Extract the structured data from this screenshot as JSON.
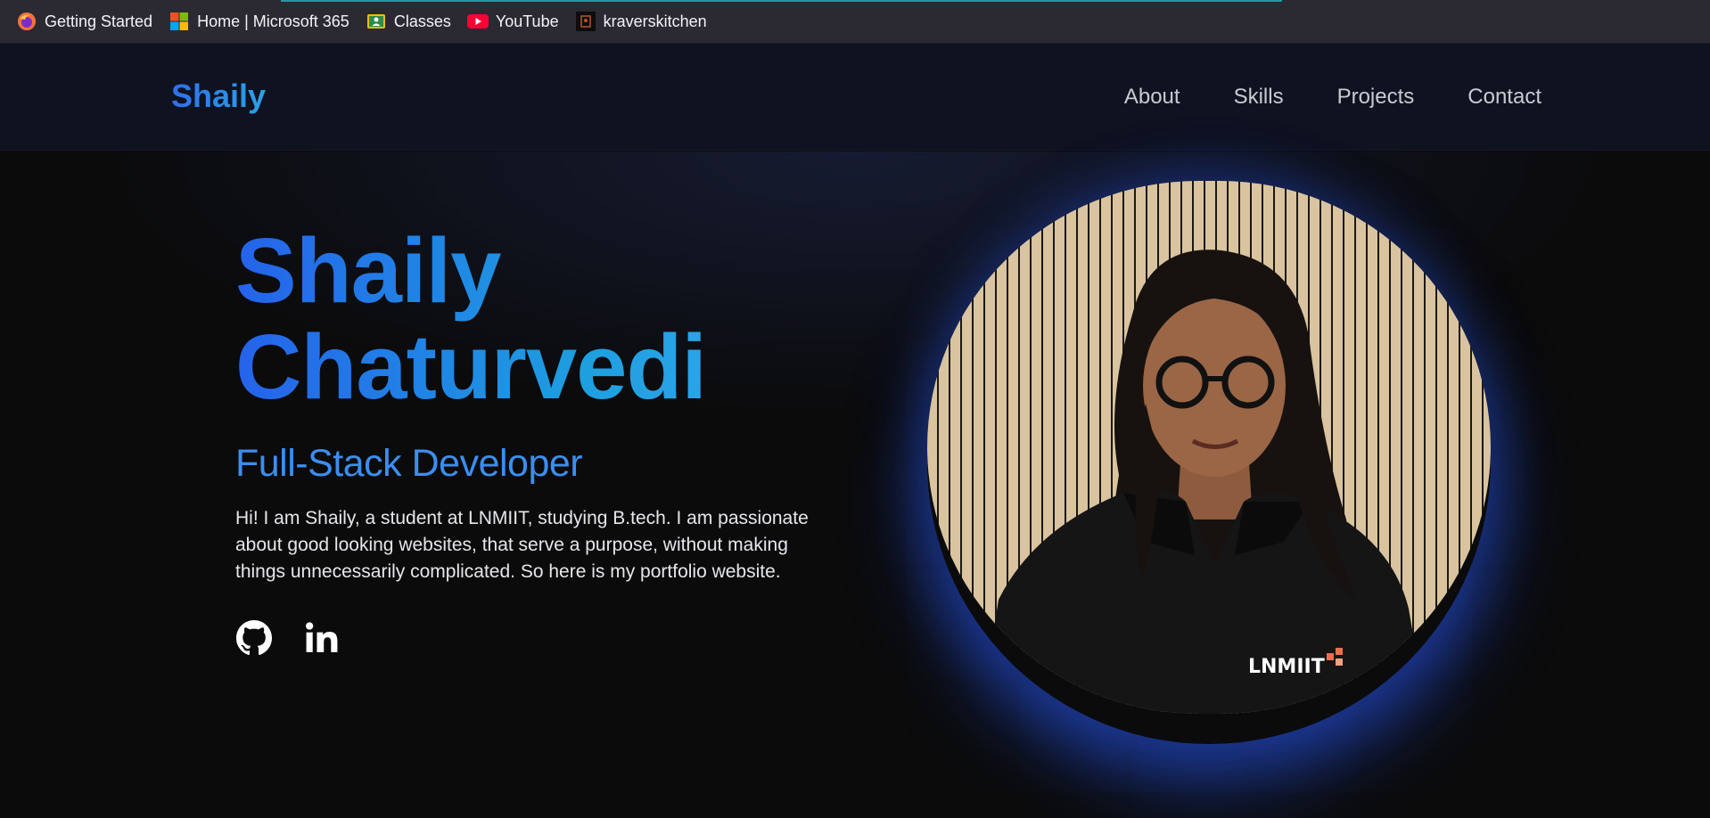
{
  "bookmarks": [
    {
      "label": "Getting Started",
      "icon": "firefox-icon"
    },
    {
      "label": "Home | Microsoft 365",
      "icon": "microsoft-icon"
    },
    {
      "label": "Classes",
      "icon": "classroom-icon"
    },
    {
      "label": "YouTube",
      "icon": "youtube-icon"
    },
    {
      "label": "kraverskitchen",
      "icon": "site-icon"
    }
  ],
  "header": {
    "brand": "Shaily",
    "nav": [
      "About",
      "Skills",
      "Projects",
      "Contact"
    ]
  },
  "hero": {
    "first_name": "Shaily",
    "last_name": "Chaturvedi",
    "role": "Full-Stack Developer",
    "intro": "Hi! I am Shaily, a student at LNMIIT, studying B.tech. I am passionate about good looking websites, that serve a purpose, without making things unnecessarily complicated. So here is my portfolio website.",
    "socials": [
      {
        "name": "github-icon"
      },
      {
        "name": "linkedin-icon"
      }
    ],
    "portrait_text": "LNMIIT"
  },
  "colors": {
    "accent": "#2563eb",
    "accent_light": "#38a8ee",
    "role": "#3b8ef0",
    "glow": "#2550dc"
  }
}
